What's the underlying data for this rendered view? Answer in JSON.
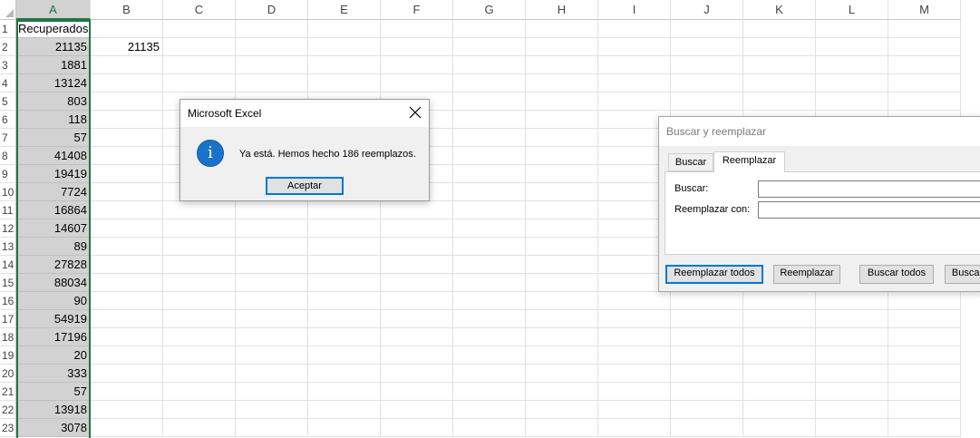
{
  "columns": [
    "A",
    "B",
    "C",
    "D",
    "E",
    "F",
    "G",
    "H",
    "I",
    "J",
    "K",
    "L",
    "M"
  ],
  "rows": [
    "1",
    "2",
    "3",
    "4",
    "5",
    "6",
    "7",
    "8",
    "9",
    "10",
    "11",
    "12",
    "13",
    "14",
    "15",
    "16",
    "17",
    "18",
    "19",
    "20",
    "21",
    "22",
    "23"
  ],
  "colA": [
    "Recuperados",
    "21135",
    "1881",
    "13124",
    "803",
    "118",
    "57",
    "41408",
    "19419",
    "7724",
    "16864",
    "14607",
    "89",
    "27828",
    "88034",
    "90",
    "54919",
    "17196",
    "20",
    "333",
    "57",
    "13918",
    "3078"
  ],
  "cellB2": "21135",
  "message_box": {
    "title": "Microsoft Excel",
    "icon": "info-icon",
    "message": "Ya está. Hemos hecho 186 reemplazos.",
    "ok_label": "Aceptar"
  },
  "find_replace": {
    "title": "Buscar y reemplazar",
    "tab_find": "Buscar",
    "tab_replace": "Reemplazar",
    "find_label": "Buscar:",
    "replace_label": "Reemplazar con:",
    "find_value": "",
    "replace_value": "",
    "btn_replace_all": "Reemplazar todos",
    "btn_replace": "Reemplazar",
    "btn_find_all": "Buscar todos",
    "btn_find_next": "Buscar"
  },
  "colors": {
    "selection_green": "#217346",
    "selected_fill": "#d2d2d2",
    "focus_blue": "#0078d7"
  }
}
